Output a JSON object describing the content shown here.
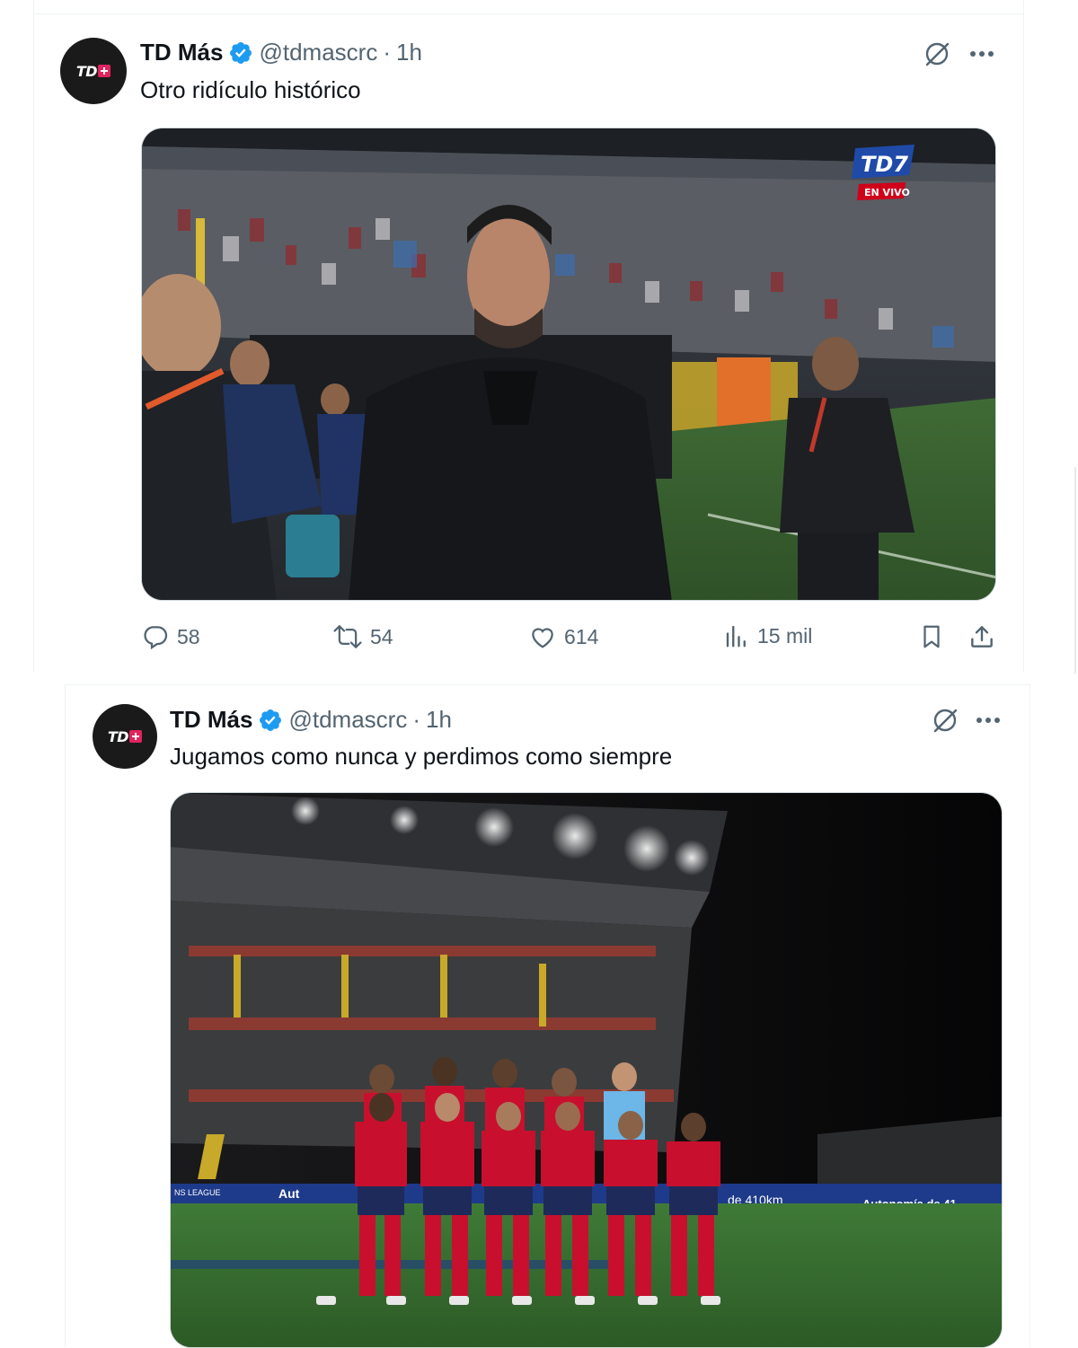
{
  "tweets": [
    {
      "avatar_text": "TD",
      "display_name": "TD Más",
      "handle": "@tdmascrc",
      "separator": "·",
      "time": "1h",
      "text": "Otro ridículo histórico",
      "media_overlay": {
        "badge_text": "TD7",
        "badge_subtext": "EN VIVO"
      },
      "stats": {
        "replies": "58",
        "reposts": "54",
        "likes": "614",
        "views": "15 mil"
      }
    },
    {
      "avatar_text": "TD",
      "display_name": "TD Más",
      "handle": "@tdmascrc",
      "separator": "·",
      "time": "1h",
      "text": "Jugamos como nunca y perdimos como siempre",
      "media_overlay": {
        "ad_left": "Aut",
        "ad_mid": "de 410km",
        "ad_right": "Autonomía de 41",
        "ad_sub": "NS LEAGUE"
      }
    }
  ],
  "colors": {
    "verified": "#1d9bf0",
    "secondary_text": "#536471",
    "primary_text": "#0f1419",
    "kit_red": "#c8102e",
    "kit_navy": "#1e2a5a"
  }
}
